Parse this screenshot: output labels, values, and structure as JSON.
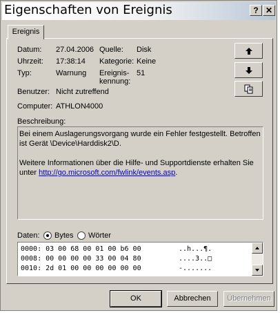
{
  "window": {
    "title": "Eigenschaften von Ereignis",
    "help_button": "?",
    "close_button": "✕"
  },
  "tab": {
    "label": "Ereignis"
  },
  "event": {
    "date_label": "Datum:",
    "date_value": "27.04.2006",
    "time_label": "Uhrzeit:",
    "time_value": "17:38:14",
    "type_label": "Typ:",
    "type_value": "Warnung",
    "user_label": "Benutzer:",
    "user_value": "Nicht zutreffend",
    "computer_label": "Computer:",
    "computer_value": "ATHLON4000",
    "source_label": "Quelle:",
    "source_value": "Disk",
    "category_label": "Kategorie:",
    "category_value": "Keine",
    "id_label_line1": "Ereignis-",
    "id_label_line2": "kennung:",
    "id_value": "51"
  },
  "nav_icons": [
    "arrow-up-icon",
    "arrow-down-icon",
    "copy-icon"
  ],
  "description": {
    "label": "Beschreibung:",
    "line1": "Bei einem Auslagerungsvorgang wurde ein Fehler festgestellt. Betroffen ist Gerät \\Device\\Harddisk2\\D.",
    "line2_prefix": "Weitere Informationen über die Hilfe- und Supportdienste erhalten Sie unter ",
    "link": "http://go.microsoft.com/fwlink/events.asp",
    "line2_suffix": "."
  },
  "data": {
    "label": "Daten:",
    "option_bytes": "Bytes",
    "option_words": "Wörter",
    "selected": "Bytes",
    "rows": [
      {
        "hex": "0000: 03 00 68 00 01 00 b6 00",
        "ascii": "..h...¶."
      },
      {
        "hex": "0008: 00 00 00 00 33 00 04 80",
        "ascii": "....3..□"
      },
      {
        "hex": "0010: 2d 01 00 00 00 00 00 00",
        "ascii": "-......."
      }
    ]
  },
  "buttons": {
    "ok": "OK",
    "cancel": "Abbrechen",
    "apply": "Übernehmen"
  }
}
